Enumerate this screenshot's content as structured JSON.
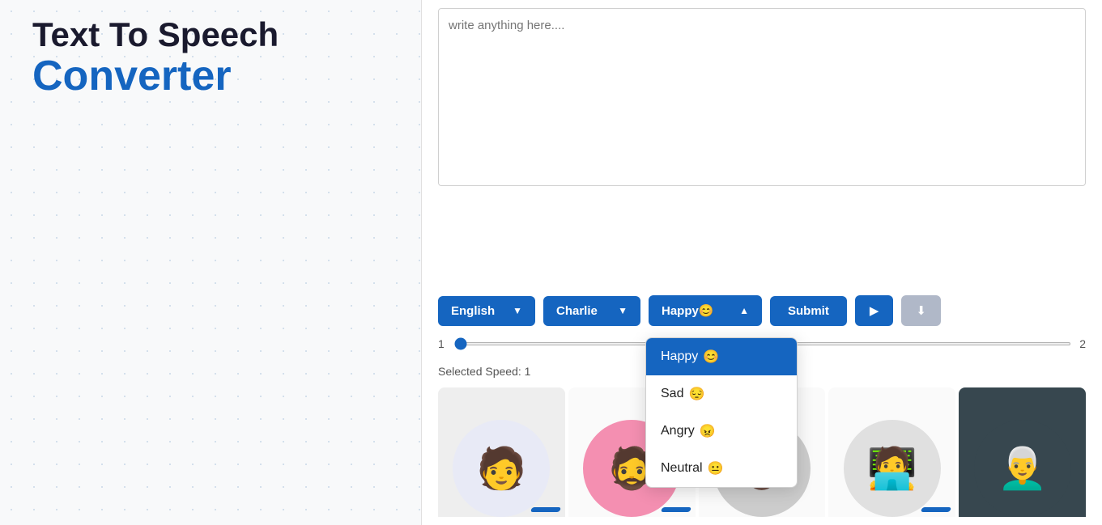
{
  "app": {
    "title_line1": "Text To Speech",
    "title_line2": "Converter"
  },
  "textarea": {
    "placeholder": "write anything here...."
  },
  "controls": {
    "language_label": "English",
    "voice_label": "Charlie",
    "emotion_label": "Happy😊",
    "submit_label": "Submit",
    "play_icon": "▶",
    "download_icon": "⬇"
  },
  "emotions": [
    {
      "id": "happy",
      "label": "Happy",
      "emoji": "😊",
      "selected": true
    },
    {
      "id": "sad",
      "label": "Sad",
      "emoji": "😔",
      "selected": false
    },
    {
      "id": "angry",
      "label": "Angry",
      "emoji": "😠",
      "selected": false
    },
    {
      "id": "neutral",
      "label": "Neutral",
      "emoji": "😐",
      "selected": false
    }
  ],
  "speed": {
    "min": "1",
    "max": "2",
    "value": 1,
    "selected_label": "Selected Speed: 1"
  },
  "avatars": [
    {
      "id": "avatar1",
      "emoji": "🧑",
      "bg": "bg-light"
    },
    {
      "id": "avatar2",
      "emoji": "🧔",
      "bg": "bg-pink"
    },
    {
      "id": "avatar3",
      "emoji": "👨🏿",
      "bg": "bg-gray"
    },
    {
      "id": "avatar4",
      "emoji": "🧑‍💻",
      "bg": "bg-white"
    },
    {
      "id": "avatar5",
      "emoji": "👨‍🦳",
      "bg": "bg-dark"
    }
  ]
}
